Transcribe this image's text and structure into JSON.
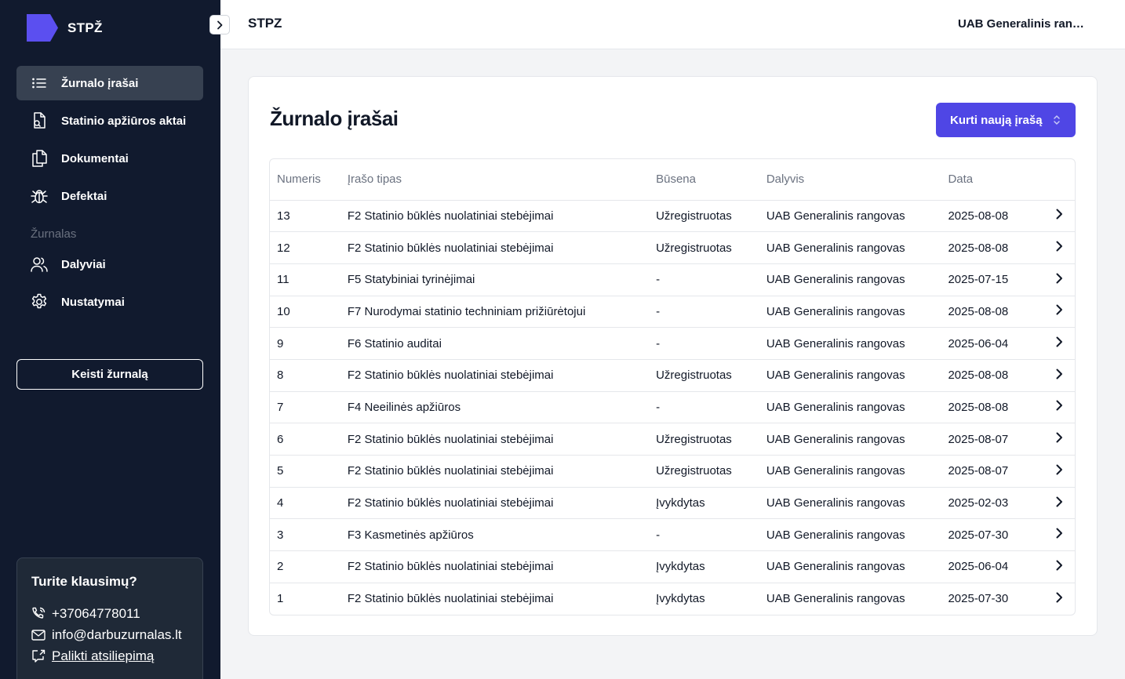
{
  "app": {
    "logo_text": "STPŽ"
  },
  "sidebar": {
    "items": [
      {
        "label": "Žurnalo įrašai",
        "icon": "list-icon",
        "active": true
      },
      {
        "label": "Statinio apžiūros aktai",
        "icon": "document-search-icon"
      },
      {
        "label": "Dokumentai",
        "icon": "documents-icon"
      },
      {
        "label": "Defektai",
        "icon": "bug-icon"
      }
    ],
    "section_label": "Žurnalas",
    "section_items": [
      {
        "label": "Dalyviai",
        "icon": "users-icon"
      },
      {
        "label": "Nustatymai",
        "icon": "gear-icon"
      }
    ],
    "switch_button": "Keisti žurnalą",
    "help": {
      "title": "Turite klausimų?",
      "phone": "+37064778011",
      "email": "info@darbuzurnalas.lt",
      "feedback": "Palikti atsiliepimą"
    }
  },
  "header": {
    "title": "STPZ",
    "user": "UAB Generalinis rangovas"
  },
  "main": {
    "title": "Žurnalo įrašai",
    "new_button": "Kurti naują įrašą",
    "columns": [
      "Numeris",
      "Įrašo tipas",
      "Būsena",
      "Dalyvis",
      "Data"
    ],
    "rows": [
      [
        "13",
        "F2 Statinio būklės nuolatiniai stebėjimai",
        "Užregistruotas",
        "UAB Generalinis rangovas",
        "2025-08-08"
      ],
      [
        "12",
        "F2 Statinio būklės nuolatiniai stebėjimai",
        "Užregistruotas",
        "UAB Generalinis rangovas",
        "2025-08-08"
      ],
      [
        "11",
        "F5 Statybiniai tyrinėjimai",
        "-",
        "UAB Generalinis rangovas",
        "2025-07-15"
      ],
      [
        "10",
        "F7 Nurodymai statinio techniniam prižiūrėtojui",
        "-",
        "UAB Generalinis rangovas",
        "2025-08-08"
      ],
      [
        "9",
        "F6 Statinio auditai",
        "-",
        "UAB Generalinis rangovas",
        "2025-06-04"
      ],
      [
        "8",
        "F2 Statinio būklės nuolatiniai stebėjimai",
        "Užregistruotas",
        "UAB Generalinis rangovas",
        "2025-08-08"
      ],
      [
        "7",
        "F4 Neeilinės apžiūros",
        "-",
        "UAB Generalinis rangovas",
        "2025-08-08"
      ],
      [
        "6",
        "F2 Statinio būklės nuolatiniai stebėjimai",
        "Užregistruotas",
        "UAB Generalinis rangovas",
        "2025-08-07"
      ],
      [
        "5",
        "F2 Statinio būklės nuolatiniai stebėjimai",
        "Užregistruotas",
        "UAB Generalinis rangovas",
        "2025-08-07"
      ],
      [
        "4",
        "F2 Statinio būklės nuolatiniai stebėjimai",
        "Įvykdytas",
        "UAB Generalinis rangovas",
        "2025-02-03"
      ],
      [
        "3",
        "F3 Kasmetinės apžiūros",
        "-",
        "UAB Generalinis rangovas",
        "2025-07-30"
      ],
      [
        "2",
        "F2 Statinio būklės nuolatiniai stebėjimai",
        "Įvykdytas",
        "UAB Generalinis rangovas",
        "2025-06-04"
      ],
      [
        "1",
        "F2 Statinio būklės nuolatiniai stebėjimai",
        "Įvykdytas",
        "UAB Generalinis rangovas",
        "2025-07-30"
      ]
    ]
  },
  "colors": {
    "sidebar_bg": "#111a2e",
    "accent": "#4f46e5",
    "active_item": "#374151"
  }
}
